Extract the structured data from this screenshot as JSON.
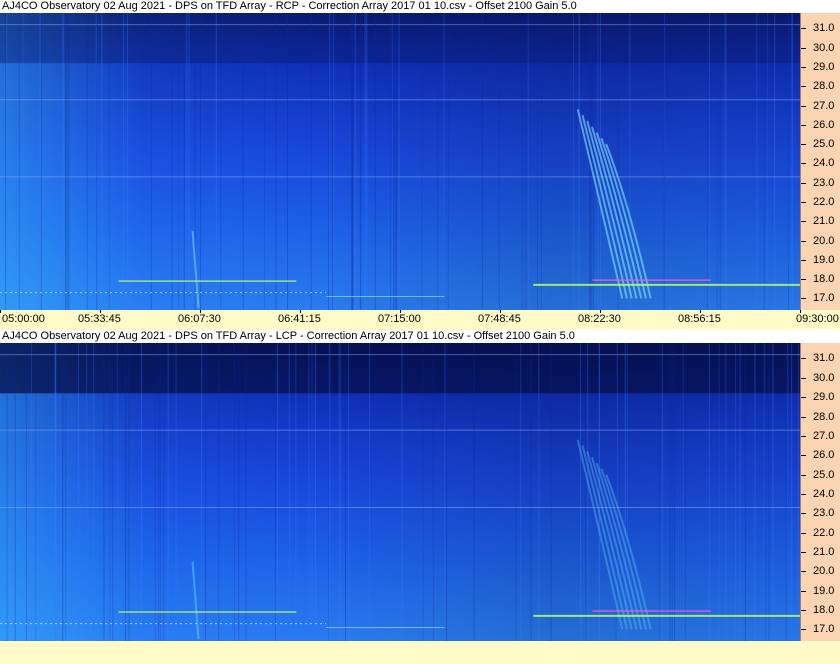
{
  "chart_data": [
    {
      "type": "heatmap",
      "title": "AJ4CO Observatory 02 Aug 2021  -  DPS on TFD Array  -  RCP  -  Correction Array 2017 01 10.csv  -  Offset 2100  Gain 5.0",
      "y_ticks": [
        "31.0",
        "30.0",
        "29.0",
        "28.0",
        "27.0",
        "26.0",
        "25.0",
        "24.0",
        "23.0",
        "22.0",
        "21.0",
        "20.0",
        "19.0",
        "18.0",
        "17.0"
      ],
      "y_tick_values": [
        31,
        30,
        29,
        28,
        27,
        26,
        25,
        24,
        23,
        22,
        21,
        20,
        19,
        18,
        17
      ],
      "ylim": [
        16.4,
        31.8
      ],
      "x_ticks": [
        "05:00:00",
        "05:33:45",
        "06:07:30",
        "06:41:15",
        "07:15:00",
        "07:48:45",
        "08:22:30",
        "08:56:15",
        "09:30:00"
      ],
      "x_tick_minutes": [
        0,
        33.75,
        67.5,
        101.25,
        135,
        168.75,
        202.5,
        236.25,
        270
      ],
      "colors": {
        "dark": "#0a1a6e",
        "mid": "#1845d8",
        "bright": "#2a7cf0",
        "burst": "#8ff0ff",
        "rfi_green": "#b8ff6a",
        "rfi_magenta": "#ff5ad0"
      }
    },
    {
      "type": "heatmap",
      "title": "AJ4CO Observatory 02 Aug 2021  -  DPS on TFD Array  -  LCP  -  Correction Array 2017 01 10.csv  -  Offset 2100  Gain 5.0",
      "y_ticks": [
        "31.0",
        "30.0",
        "29.0",
        "28.0",
        "27.0",
        "26.0",
        "25.0",
        "24.0",
        "23.0",
        "22.0",
        "21.0",
        "20.0",
        "19.0",
        "18.0",
        "17.0"
      ],
      "y_tick_values": [
        31,
        30,
        29,
        28,
        27,
        26,
        25,
        24,
        23,
        22,
        21,
        20,
        19,
        18,
        17
      ],
      "ylim": [
        16.4,
        31.8
      ],
      "x_ticks": [],
      "x_tick_minutes": [],
      "colors": {
        "dark": "#050f4a",
        "mid": "#1845d8",
        "bright": "#2a7cf0",
        "burst": "#6fd8ff",
        "rfi_green": "#b8ff6a",
        "rfi_magenta": "#ff5ad0"
      }
    }
  ]
}
